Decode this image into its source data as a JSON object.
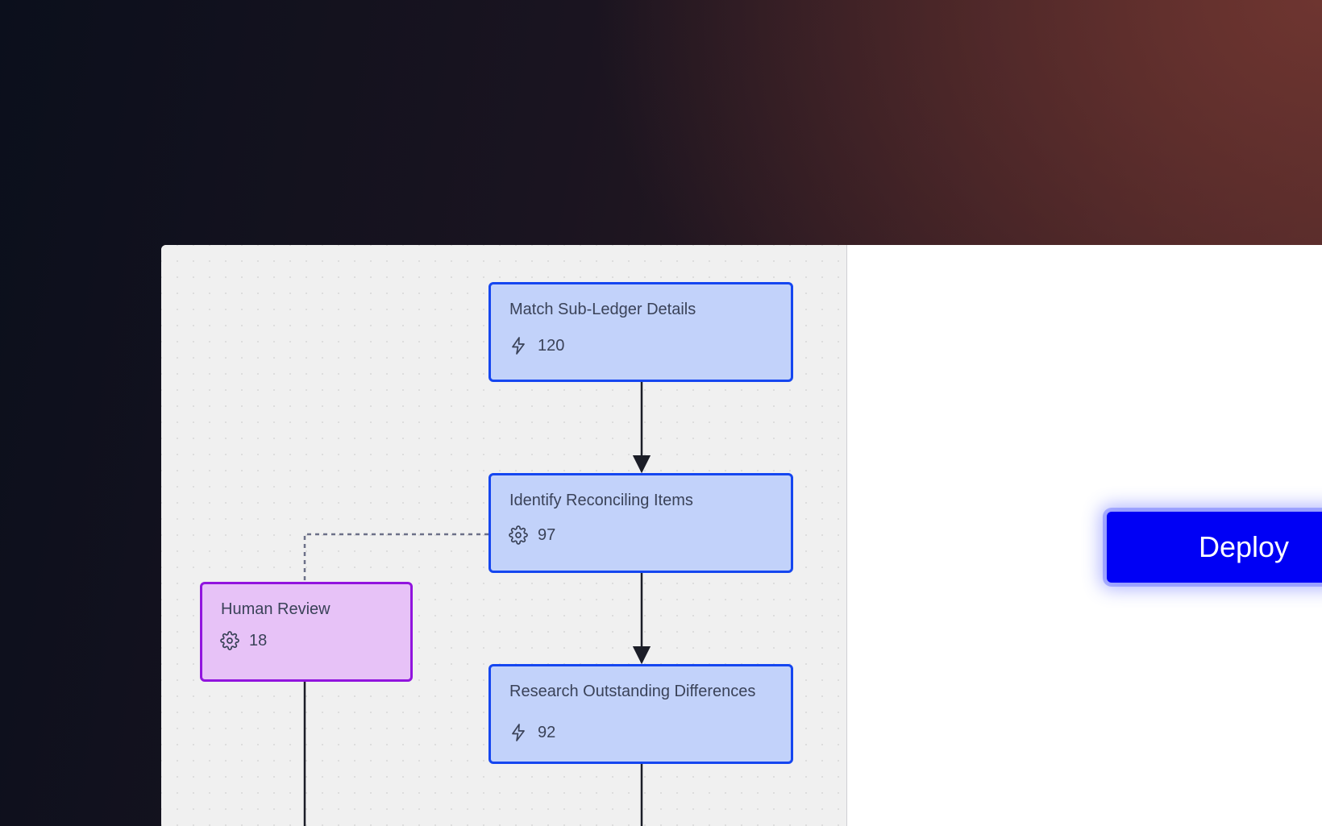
{
  "workflow": {
    "nodes": [
      {
        "id": "match",
        "title": "Match Sub-Ledger Details",
        "icon": "lightning-icon",
        "count": "120"
      },
      {
        "id": "identify",
        "title": "Identify Reconciling Items",
        "icon": "gear-icon",
        "count": "97"
      },
      {
        "id": "review",
        "title": "Human Review",
        "icon": "gear-icon",
        "count": "18"
      },
      {
        "id": "research",
        "title": "Research Outstanding Differences",
        "icon": "lightning-icon",
        "count": "92"
      }
    ]
  },
  "panel": {
    "deploy_label": "Deploy"
  },
  "colors": {
    "node_border": "#1546f0",
    "node_fill": "#c2d2fa",
    "review_border": "#9114de",
    "review_fill": "#e7c2f7",
    "deploy_button": "#0000f5"
  }
}
